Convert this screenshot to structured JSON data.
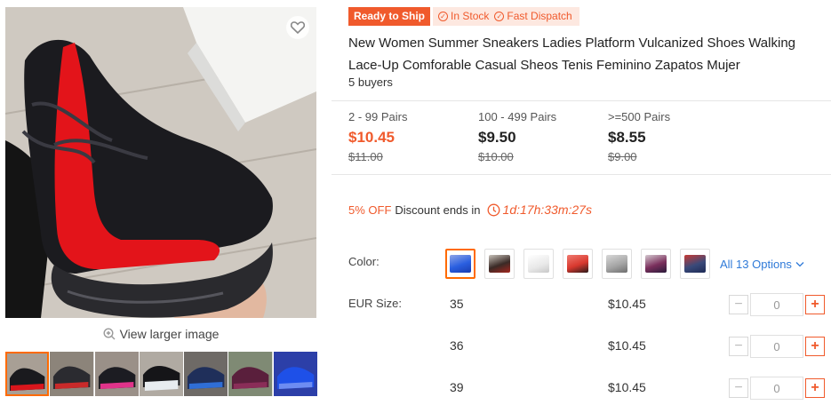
{
  "gallery": {
    "view_larger_label": "View larger image",
    "thumbnail_count": 7,
    "active_thumbnail": 1
  },
  "badges": {
    "ready_to_ship": "Ready to Ship",
    "in_stock": "In Stock",
    "fast_dispatch": "Fast Dispatch"
  },
  "product": {
    "title": "New Women Summer Sneakers Ladies Platform Vulcanized Shoes Walking Lace-Up Comforable Casual Sheos Tenis Feminino Zapatos Mujer",
    "buyers": "5 buyers"
  },
  "price_tiers": [
    {
      "range": "2 - 99 Pairs",
      "price": "$10.45",
      "original": "$11.00"
    },
    {
      "range": "100 - 499 Pairs",
      "price": "$9.50",
      "original": "$10.00"
    },
    {
      "range": ">=500 Pairs",
      "price": "$8.55",
      "original": "$9.00"
    }
  ],
  "discount": {
    "off": "5% OFF",
    "ends_label": "Discount ends in",
    "countdown": "1d:17h:33m:27s"
  },
  "color": {
    "label": "Color:",
    "swatches": [
      {
        "name": "blue",
        "color": "#2a5fe0"
      },
      {
        "name": "black-red",
        "color": "#5a3b2e"
      },
      {
        "name": "white",
        "color": "#e8e8e8"
      },
      {
        "name": "red",
        "color": "#d8382e"
      },
      {
        "name": "grey",
        "color": "#a6a6a6"
      },
      {
        "name": "purple",
        "color": "#7a2f5c"
      },
      {
        "name": "navy-red",
        "color": "#3a4a7a"
      }
    ],
    "all_options": "All 13 Options"
  },
  "size": {
    "label": "EUR Size:",
    "rows": [
      {
        "size": "35",
        "price": "$10.45",
        "qty": "0"
      },
      {
        "size": "36",
        "price": "$10.45",
        "qty": "0"
      },
      {
        "size": "39",
        "price": "$10.45",
        "qty": "0"
      }
    ]
  },
  "colors": {
    "accent": "#f05a2c",
    "link": "#2f7ad8",
    "selected_border": "#ff6a00"
  }
}
